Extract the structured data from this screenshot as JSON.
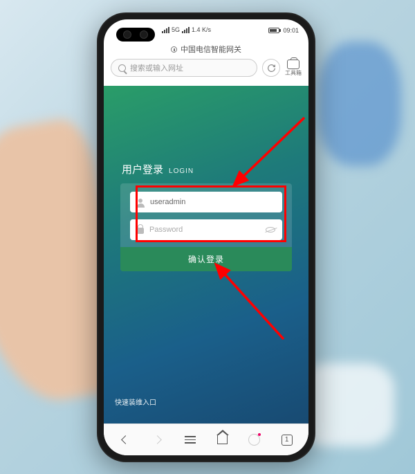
{
  "status": {
    "network": "5G",
    "speed": "1.4 K/s",
    "time": "09:01"
  },
  "browser": {
    "site_title": "中国电信智能网关",
    "search_placeholder": "搜索或输入网址",
    "toolbox_label": "工具箱"
  },
  "login": {
    "title_cn": "用户登录",
    "title_en": "LOGIN",
    "username_value": "useradmin",
    "password_placeholder": "Password",
    "submit_label": "确认登录",
    "quick_link": "快速装维入口"
  },
  "bottom_nav": {
    "tab_count": "1"
  },
  "colors": {
    "annotation_red": "#ff0000",
    "login_btn_green": "#2a8a5a"
  }
}
